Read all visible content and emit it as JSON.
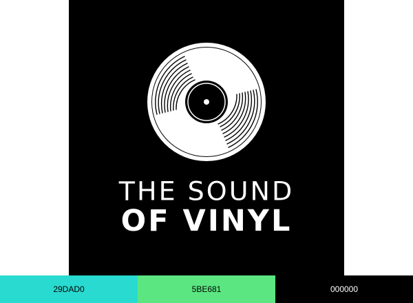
{
  "logo": {
    "title_line1": "THE SOUND",
    "title_line2": "OF VINYL",
    "icon": "vinyl-record-icon"
  },
  "palette": [
    {
      "label": "29DAD0",
      "color": "#29DAD0",
      "text_color": "#000000"
    },
    {
      "label": "5BE681",
      "color": "#5BE681",
      "text_color": "#000000"
    },
    {
      "label": "000000",
      "color": "#000000",
      "text_color": "#ffffff"
    }
  ]
}
